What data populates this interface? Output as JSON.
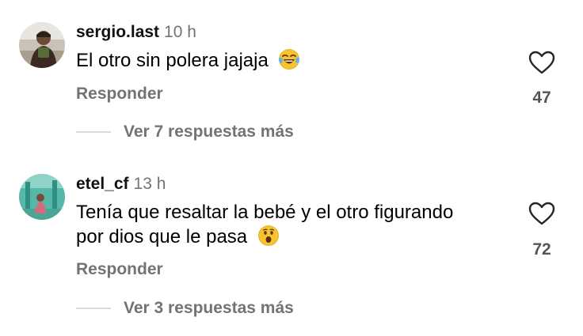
{
  "comments": [
    {
      "username": "sergio.last",
      "time": "10 h",
      "text": "El otro sin polera jajaja",
      "emoji": "tears-of-joy-emoji",
      "reply_label": "Responder",
      "likes": "47",
      "more_replies": "Ver 7 respuestas más"
    },
    {
      "username": "etel_cf",
      "time": "13 h",
      "text_line1": "Tenía que resaltar la bebé y el otro figurando",
      "text_line2": "por dios que le pasa",
      "emoji": "surprised-face-emoji",
      "reply_label": "Responder",
      "likes": "72",
      "more_replies": "Ver 3 respuestas más"
    }
  ],
  "colors": {
    "secondary_text": "#737373",
    "heart_stroke": "#262626",
    "divider": "#dbdbdb"
  }
}
